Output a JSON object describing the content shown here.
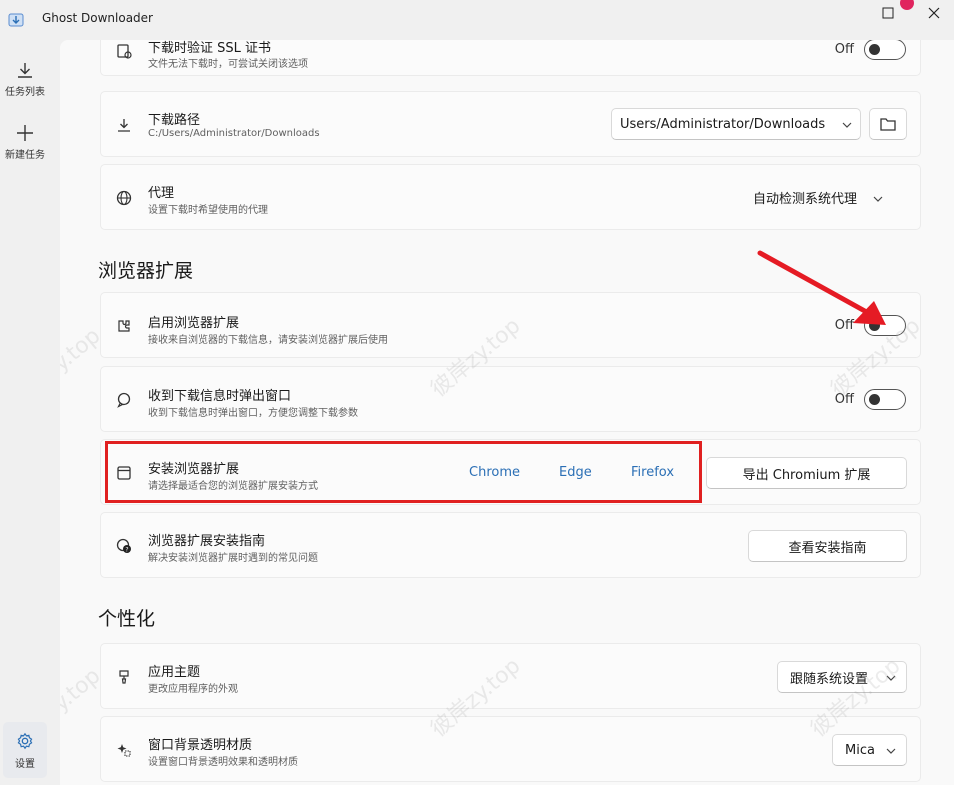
{
  "window": {
    "title": "Ghost Downloader"
  },
  "sidebar": {
    "items": [
      {
        "label": "任务列表",
        "icon": "download-icon"
      },
      {
        "label": "新建任务",
        "icon": "plus-icon"
      }
    ],
    "settings": {
      "label": "设置",
      "icon": "gear-icon"
    }
  },
  "download": {
    "ssl": {
      "title": "下载时验证 SSL 证书",
      "subtitle": "文件无法下载时，可尝试关闭该选项",
      "toggle_label": "Off"
    },
    "path": {
      "title": "下载路径",
      "subtitle": "C:/Users/Administrator/Downloads",
      "value": "Users/Administrator/Downloads"
    },
    "proxy": {
      "title": "代理",
      "subtitle": "设置下载时希望使用的代理",
      "value": "自动检测系统代理"
    }
  },
  "browser_ext": {
    "section_title": "浏览器扩展",
    "enable": {
      "title": "启用浏览器扩展",
      "subtitle": "接收来自浏览器的下载信息，请安装浏览器扩展后使用",
      "toggle_label": "Off"
    },
    "popup": {
      "title": "收到下载信息时弹出窗口",
      "subtitle": "收到下载信息时弹出窗口，方便您调整下载参数",
      "toggle_label": "Off"
    },
    "install": {
      "title": "安装浏览器扩展",
      "subtitle": "请选择最适合您的浏览器扩展安装方式",
      "links": [
        "Chrome",
        "Edge",
        "Firefox"
      ],
      "export_button": "导出 Chromium 扩展"
    },
    "guide": {
      "title": "浏览器扩展安装指南",
      "subtitle": "解决安装浏览器扩展时遇到的常见问题",
      "button": "查看安装指南"
    }
  },
  "personalize": {
    "section_title": "个性化",
    "theme": {
      "title": "应用主题",
      "subtitle": "更改应用程序的外观",
      "value": "跟随系统设置"
    },
    "backdrop": {
      "title": "窗口背景透明材质",
      "subtitle": "设置窗口背景透明效果和透明材质",
      "value": "Mica"
    }
  },
  "watermark": "彼岸zy.top",
  "colors": {
    "accent": "#2b6fb5",
    "highlight": "#e02020",
    "arrow": "#e51b24"
  }
}
